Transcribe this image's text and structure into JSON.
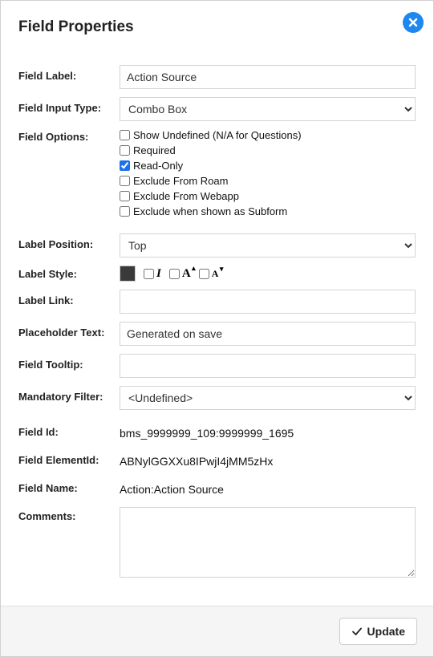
{
  "title": "Field Properties",
  "labels": {
    "fieldLabel": "Field Label:",
    "fieldInputType": "Field Input Type:",
    "fieldOptions": "Field Options:",
    "labelPosition": "Label Position:",
    "labelStyle": "Label Style:",
    "labelLink": "Label Link:",
    "placeholderText": "Placeholder Text:",
    "fieldTooltip": "Field Tooltip:",
    "mandatoryFilter": "Mandatory Filter:",
    "fieldId": "Field Id:",
    "fieldElementId": "Field ElementId:",
    "fieldName": "Field Name:",
    "comments": "Comments:"
  },
  "values": {
    "fieldLabel": "Action Source",
    "fieldInputType": "Combo Box",
    "labelPosition": "Top",
    "labelLink": "",
    "placeholderText": "Generated on save",
    "fieldTooltip": "",
    "mandatoryFilter": "<Undefined>",
    "fieldId": "bms_9999999_109:9999999_1695",
    "fieldElementId": "ABNylGGXXu8IPwjI4jMM5zHx",
    "fieldName": "Action:Action Source",
    "comments": ""
  },
  "options": {
    "showUndefined": {
      "label": "Show Undefined (N/A for Questions)",
      "checked": false
    },
    "required": {
      "label": "Required",
      "checked": false
    },
    "readOnly": {
      "label": "Read-Only",
      "checked": true
    },
    "excludeRoam": {
      "label": "Exclude From Roam",
      "checked": false
    },
    "excludeWebapp": {
      "label": "Exclude From Webapp",
      "checked": false
    },
    "excludeSubform": {
      "label": "Exclude when shown as Subform",
      "checked": false
    }
  },
  "labelStyle": {
    "color": "#3a3a3a",
    "italic": false,
    "sizeUp": false,
    "sizeDown": false
  },
  "buttons": {
    "update": "Update"
  }
}
